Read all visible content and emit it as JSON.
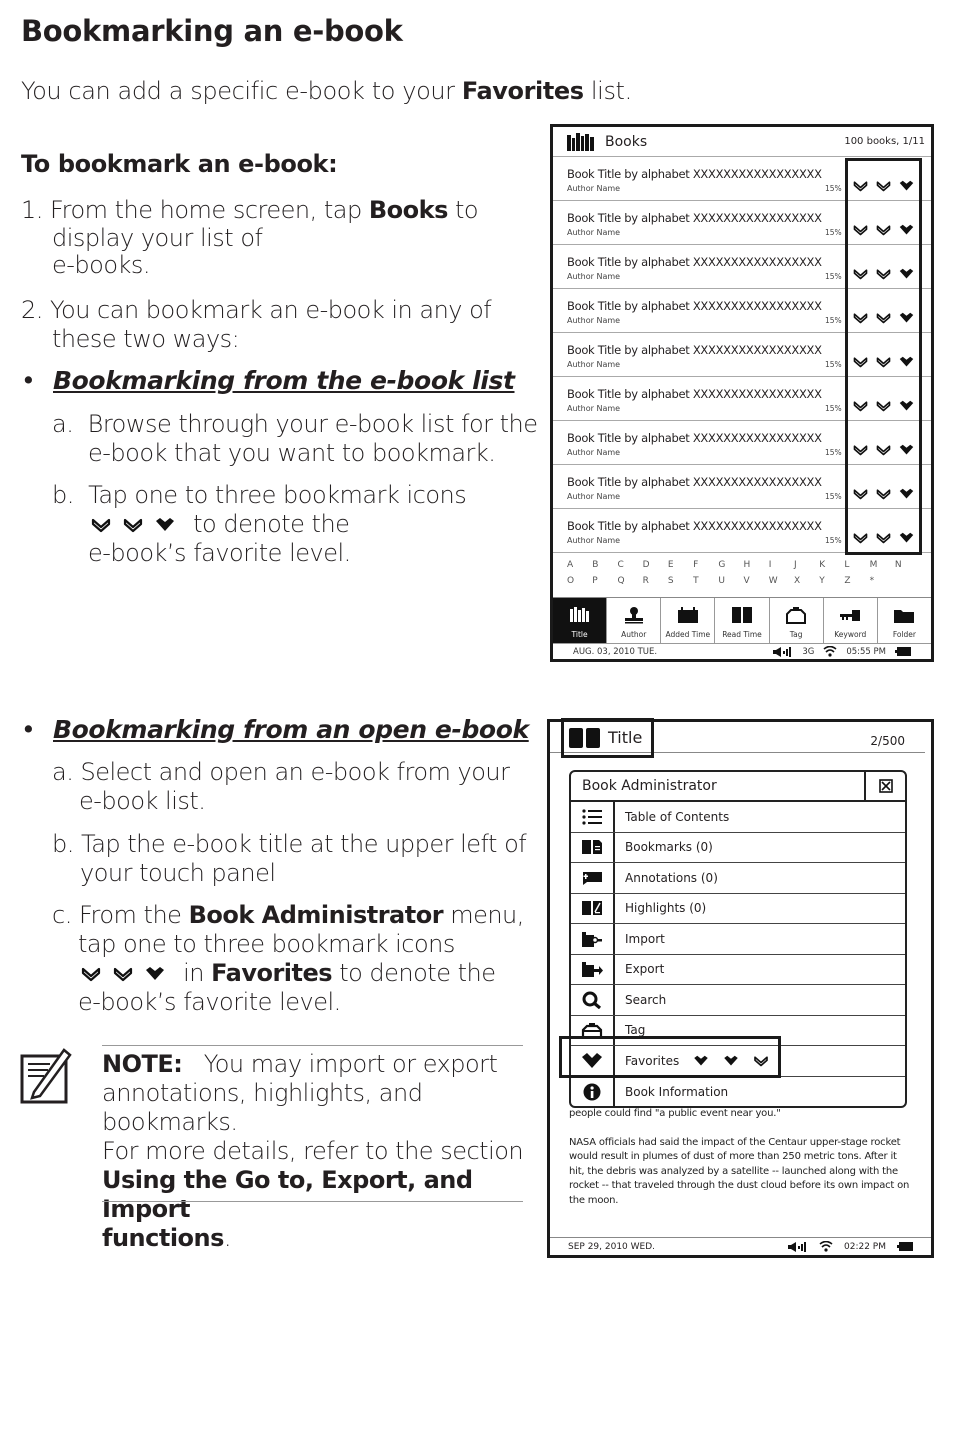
{
  "page": {
    "title": "Bookmarking an e-book",
    "intro_prefix": "You can add a specific e-book to your ",
    "intro_bold": "Favorites",
    "intro_suffix": " list.",
    "subheading": "To bookmark an e-book:",
    "steps": [
      {
        "num": "1.",
        "prefix": "From the home screen, tap ",
        "bold": "Books",
        "suffix": " to",
        "line2": "display your list of",
        "line3": "e-books."
      },
      {
        "num": "2.",
        "line1": "You can bookmark an e-book in any of",
        "line2": "these two ways:"
      }
    ],
    "method1": {
      "bullet": "•",
      "heading": "Bookmarking from the e-book list",
      "a_label": "a.",
      "a_line1": "Browse through your e-book list for the",
      "a_line2": "e-book that you want to bookmark.",
      "b_label": "b.",
      "b_line1": "Tap one to three bookmark icons",
      "b_line2": " to denote the",
      "b_line3": "e-book’s favorite level."
    },
    "method2": {
      "bullet": "•",
      "heading": "Bookmarking from an open e-book",
      "a_label": "a.",
      "a_line1": "Select and open an e-book from your",
      "a_line2": "e-book list.",
      "b_label": "b.",
      "b_line1": "Tap the e-book title at the upper left of",
      "b_line2": "your touch panel",
      "c_label": "c.",
      "c_prefix": "From the ",
      "c_bold": "Book Administrator",
      "c_suffix": " menu,",
      "c_line2": "tap one to three bookmark icons",
      "c_line3_prefix": " in ",
      "c_line3_bold": "Favorites",
      "c_line3_suffix": " to denote the",
      "c_line4": "e-book’s favorite level."
    },
    "note": {
      "icon": "note-pencil-icon",
      "label": "NOTE:",
      "line1": "   You may import or export",
      "line2": "annotations, highlights, and bookmarks.",
      "line3": "For more details, refer to the section",
      "bold_line": "Using the Go to, Export, and Import",
      "bold_line2": "functions",
      "end": "."
    }
  },
  "screen_books": {
    "header_icon": "library-icon",
    "header_title": "Books",
    "header_count": "100 books, 1/11",
    "rows": [
      {
        "title": "Book Title by alphabet XXXXXXXXXXXXXXXXX",
        "author": "Author Name",
        "progress": "15%"
      },
      {
        "title": "Book Title by alphabet XXXXXXXXXXXXXXXXX",
        "author": "Author Name",
        "progress": "15%"
      },
      {
        "title": "Book Title by alphabet XXXXXXXXXXXXXXXXX",
        "author": "Author Name",
        "progress": "15%"
      },
      {
        "title": "Book Title by alphabet XXXXXXXXXXXXXXXXX",
        "author": "Author Name",
        "progress": "15%"
      },
      {
        "title": "Book Title by alphabet XXXXXXXXXXXXXXXXX",
        "author": "Author Name",
        "progress": "15%"
      },
      {
        "title": "Book Title by alphabet XXXXXXXXXXXXXXXXX",
        "author": "Author Name",
        "progress": "15%"
      },
      {
        "title": "Book Title by alphabet XXXXXXXXXXXXXXXXX",
        "author": "Author Name",
        "progress": "15%"
      },
      {
        "title": "Book Title by alphabet XXXXXXXXXXXXXXXXX",
        "author": "Author Name",
        "progress": "15%"
      },
      {
        "title": "Book Title by alphabet XXXXXXXXXXXXXXXXX",
        "author": "Author Name",
        "progress": "15%"
      }
    ],
    "alphabet_row1": [
      "A",
      "B",
      "C",
      "D",
      "E",
      "F",
      "G",
      "H",
      "I",
      "J",
      "K",
      "L",
      "M",
      "N"
    ],
    "alphabet_row2": [
      "O",
      "P",
      "Q",
      "R",
      "S",
      "T",
      "U",
      "V",
      "W",
      "X",
      "Y",
      "Z",
      "*",
      ""
    ],
    "tabs": [
      {
        "label": "Title",
        "icon": "title-sort-icon",
        "active": true
      },
      {
        "label": "Author",
        "icon": "author-icon"
      },
      {
        "label": "Added Time",
        "icon": "added-time-icon"
      },
      {
        "label": "Read Time",
        "icon": "read-time-icon"
      },
      {
        "label": "Tag",
        "icon": "tag-icon"
      },
      {
        "label": "Keyword",
        "icon": "keyword-icon"
      },
      {
        "label": "Folder",
        "icon": "folder-icon"
      }
    ],
    "status": {
      "date": "AUG. 03, 2010 TUE.",
      "network": "3G",
      "time": "05:55 PM"
    }
  },
  "screen_reader": {
    "header_title": "Title",
    "page": "2/500",
    "menu_title": "Book Administrator",
    "menu_items": [
      {
        "label": "Table of Contents",
        "icon": "list-icon"
      },
      {
        "label": "Bookmarks (0)",
        "icon": "bookmarks-icon"
      },
      {
        "label": "Annotations (0)",
        "icon": "annotation-icon"
      },
      {
        "label": "Highlights (0)",
        "icon": "highlight-icon"
      },
      {
        "label": "Import",
        "icon": "import-icon"
      },
      {
        "label": "Export",
        "icon": "export-icon"
      },
      {
        "label": "Search",
        "icon": "search-icon"
      },
      {
        "label": "Tag",
        "icon": "tag-icon"
      },
      {
        "label": "Favorites",
        "icon": "favorite-icon"
      },
      {
        "label": "Book Information",
        "icon": "info-icon"
      }
    ],
    "reader_line0": "people could find \"a public event near you.\"",
    "reader_para": "NASA officials had said the impact of the Centaur upper-stage rocket would result in plumes of dust of more than 250 metric tons. After it hit, the debris was analyzed by a satellite -- launched along with the rocket -- that traveled through the dust cloud before its own impact on the moon.",
    "status": {
      "date": "SEP 29, 2010  WED.",
      "time": "02:22 PM"
    }
  }
}
